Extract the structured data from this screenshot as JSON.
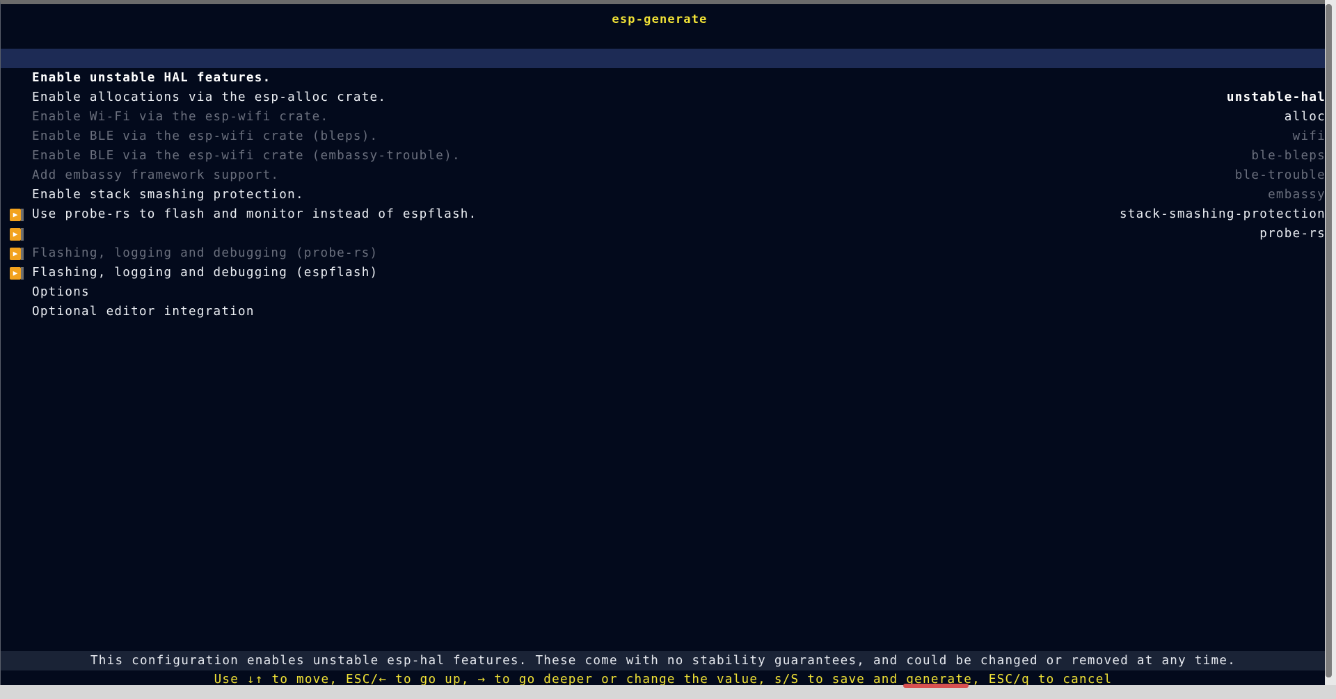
{
  "app": {
    "title": "esp-generate"
  },
  "menu": {
    "items": [
      {
        "label": "Enable unstable HAL features.",
        "value": "unstable-hal",
        "state": "selected",
        "submenu": false
      },
      {
        "label": "Enable allocations via the esp-alloc crate.",
        "value": "alloc",
        "state": "enabled",
        "submenu": false
      },
      {
        "label": "Enable Wi-Fi via the esp-wifi crate.",
        "value": "wifi",
        "state": "disabled",
        "submenu": false
      },
      {
        "label": "Enable BLE via the esp-wifi crate (bleps).",
        "value": "ble-bleps",
        "state": "disabled",
        "submenu": false
      },
      {
        "label": "Enable BLE via the esp-wifi crate (embassy-trouble).",
        "value": "ble-trouble",
        "state": "disabled",
        "submenu": false
      },
      {
        "label": "Add embassy framework support.",
        "value": "embassy",
        "state": "disabled",
        "submenu": false
      },
      {
        "label": "Enable stack smashing protection.",
        "value": "stack-smashing-protection",
        "state": "enabled",
        "submenu": false
      },
      {
        "label": "Use probe-rs to flash and monitor instead of espflash.",
        "value": "probe-rs",
        "state": "enabled",
        "submenu": false
      },
      {
        "label": "Flashing, logging and debugging (probe-rs)",
        "value": "",
        "state": "disabled",
        "submenu": true
      },
      {
        "label": "Flashing, logging and debugging (espflash)",
        "value": "",
        "state": "enabled",
        "submenu": true
      },
      {
        "label": "Options",
        "value": "",
        "state": "enabled",
        "submenu": true
      },
      {
        "label": "Optional editor integration",
        "value": "",
        "state": "enabled",
        "submenu": true
      }
    ],
    "submenu_icon": "submenu-arrow-icon"
  },
  "description": "This configuration enables unstable esp-hal features. These come with no stability guarantees, and could be changed or removed at any time.",
  "help": "Use ↓↑ to move, ESC/← to go up, → to go deeper or change the value, s/S to save and generate, ESC/q to cancel",
  "colors": {
    "background": "#030a1c",
    "selected_row": "#1d2b55",
    "title": "#f2e336",
    "help_text": "#f2e336",
    "enabled_text": "#eceff4",
    "disabled_text": "#6a6f7d",
    "submenu_marker": "#f2a21e"
  }
}
